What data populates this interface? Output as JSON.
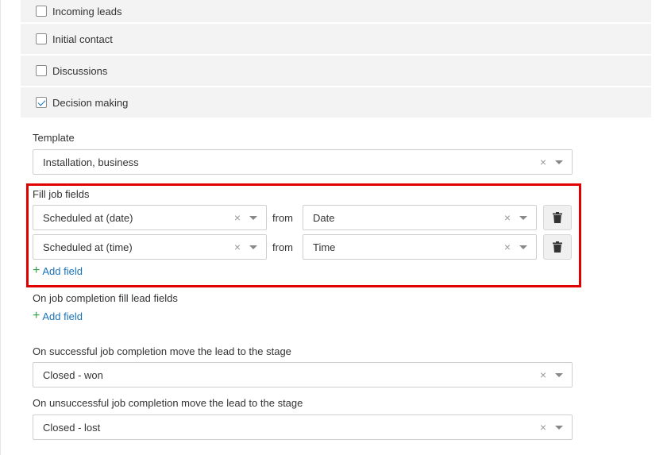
{
  "stages": [
    {
      "label": "Incoming leads",
      "checked": false
    },
    {
      "label": "Initial contact",
      "checked": false
    },
    {
      "label": "Discussions",
      "checked": false
    },
    {
      "label": "Decision making",
      "checked": true
    }
  ],
  "template": {
    "label": "Template",
    "value": "Installation, business"
  },
  "fill_job_fields": {
    "label": "Fill job fields",
    "from_label": "from",
    "rows": [
      {
        "field": "Scheduled at (date)",
        "source": "Date"
      },
      {
        "field": "Scheduled at (time)",
        "source": "Time"
      }
    ],
    "add_field_label": "Add field"
  },
  "completion_fill": {
    "label": "On job completion fill lead fields",
    "add_field_label": "Add field"
  },
  "success_stage": {
    "label": "On successful job completion move the lead to the stage",
    "value": "Closed - won"
  },
  "fail_stage": {
    "label": "On unsuccessful job completion move the lead to the stage",
    "value": "Closed - lost"
  },
  "icons": {
    "clear": "×",
    "caret": "chevron-down-icon",
    "delete": "trash-icon",
    "add": "plus-icon"
  },
  "colors": {
    "highlight": "#e00000",
    "link": "#1a73b8",
    "plus": "#35a04a"
  }
}
